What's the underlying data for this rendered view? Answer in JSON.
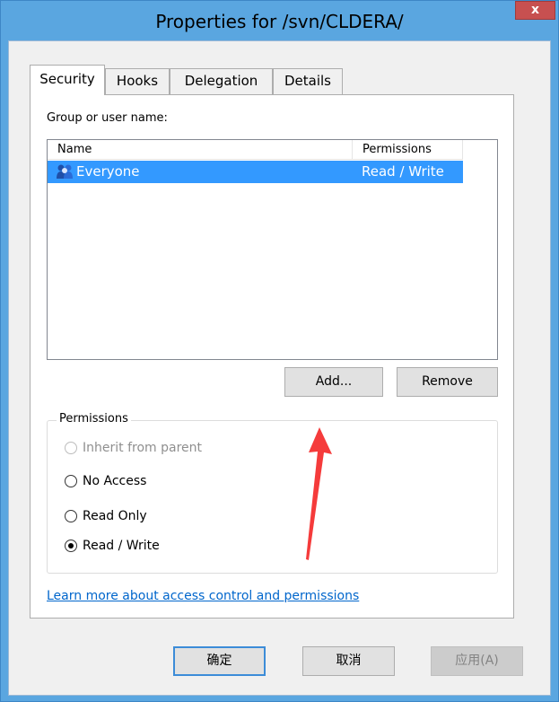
{
  "window": {
    "title": "Properties for /svn/CLDERA/",
    "close_label": "x"
  },
  "tabs": [
    {
      "label": "Security",
      "active": true
    },
    {
      "label": "Hooks",
      "active": false
    },
    {
      "label": "Delegation",
      "active": false
    },
    {
      "label": "Details",
      "active": false
    }
  ],
  "security": {
    "group_label": "Group or user name:",
    "columns": [
      "Name",
      "Permissions"
    ],
    "rows": [
      {
        "name": "Everyone",
        "permissions": "Read / Write",
        "selected": true,
        "icon": "users-group-icon"
      }
    ],
    "add_button": "Add...",
    "remove_button": "Remove",
    "permissions_legend": "Permissions",
    "options": [
      {
        "label": "Inherit from parent",
        "checked": false,
        "disabled": true
      },
      {
        "label": "No Access",
        "checked": false,
        "disabled": false
      },
      {
        "label": "Read Only",
        "checked": false,
        "disabled": false
      },
      {
        "label": "Read / Write",
        "checked": true,
        "disabled": false
      }
    ],
    "help_link": "Learn more about access control and permissions"
  },
  "footer": {
    "ok": "确定",
    "cancel": "取消",
    "apply": "应用(A)"
  },
  "colors": {
    "selection": "#3399ff",
    "frame": "#5aa6e0",
    "close": "#c75050",
    "arrow": "#f53b3b"
  }
}
